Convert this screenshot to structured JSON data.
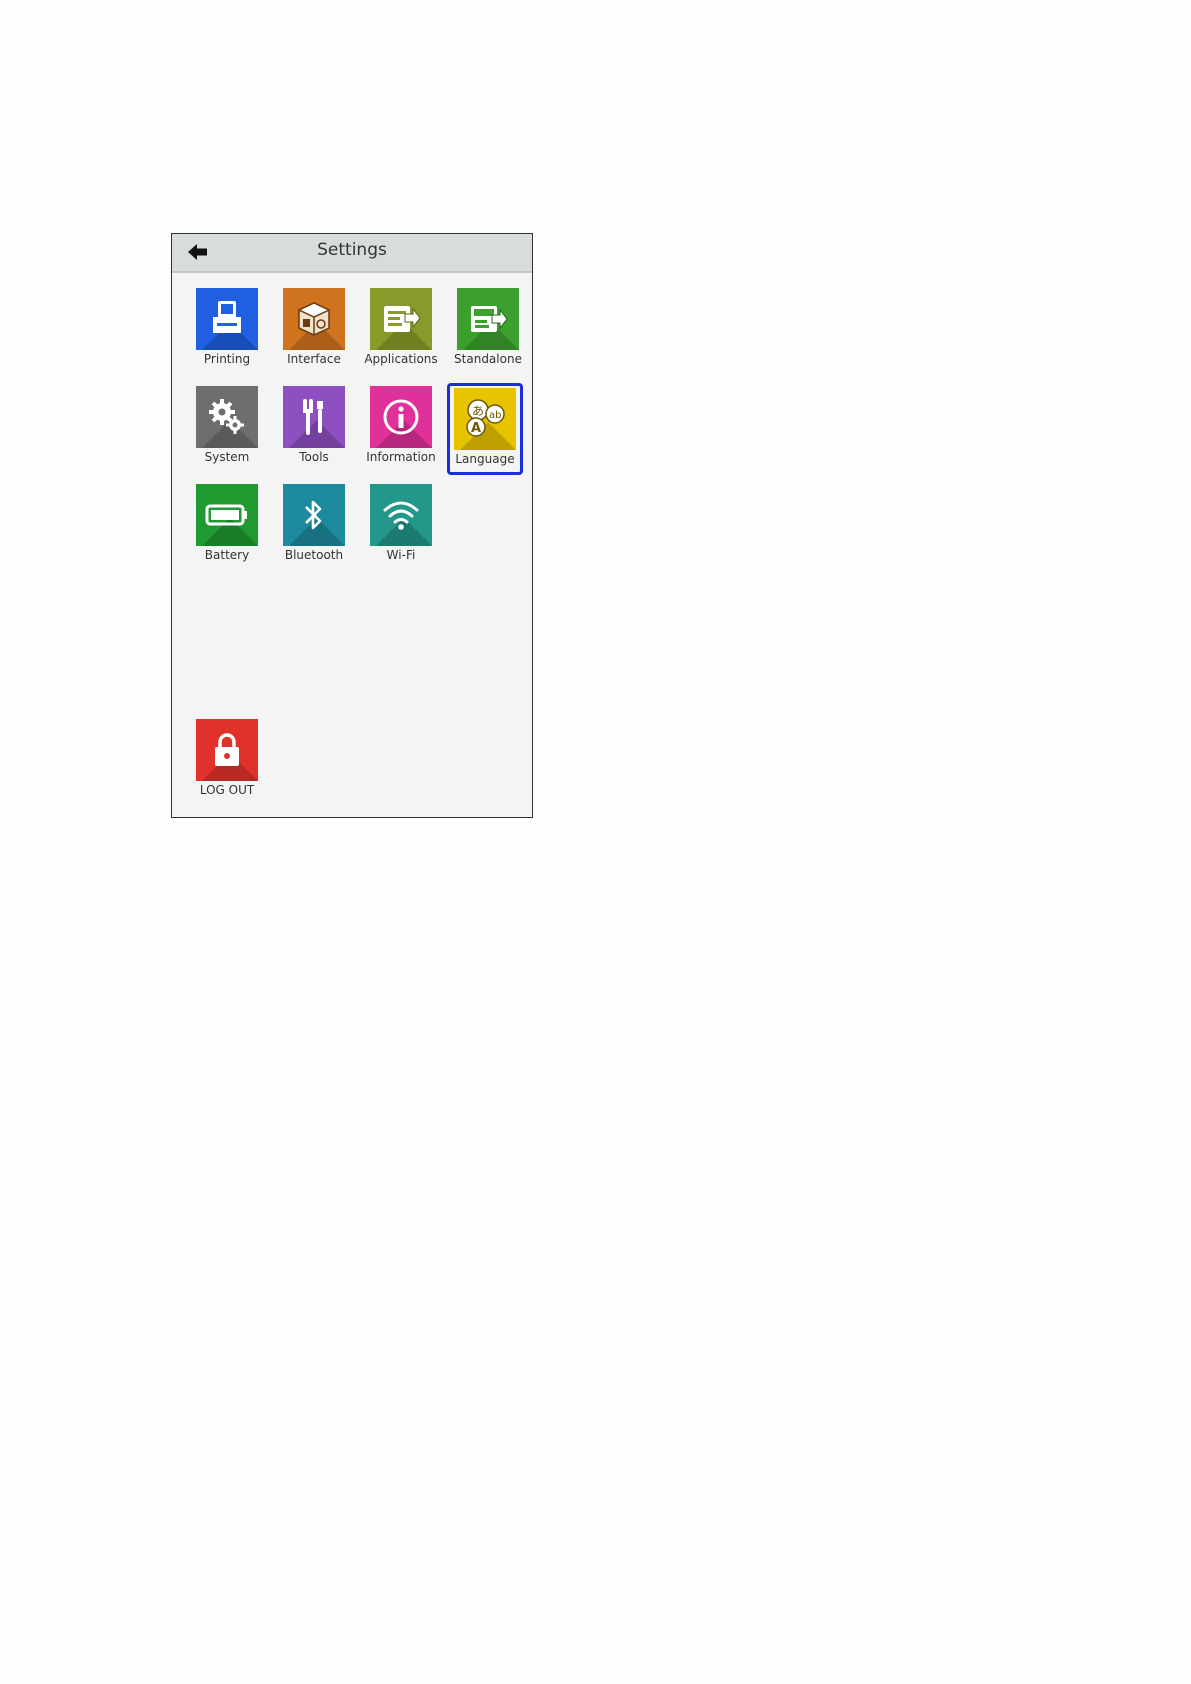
{
  "header": {
    "title": "Settings"
  },
  "items": [
    {
      "label": "Printing",
      "color": "#1f5fe0",
      "icon": "printer-icon"
    },
    {
      "label": "Interface",
      "color": "#d0731e",
      "icon": "interface-cube-icon"
    },
    {
      "label": "Applications",
      "color": "#8a9a2a",
      "icon": "applications-icon"
    },
    {
      "label": "Standalone",
      "color": "#3ca02e",
      "icon": "standalone-icon"
    },
    {
      "label": "System",
      "color": "#6e6e6e",
      "icon": "gears-icon"
    },
    {
      "label": "Tools",
      "color": "#8e4fc0",
      "icon": "tools-icon"
    },
    {
      "label": "Information",
      "color": "#e0309a",
      "icon": "info-icon"
    },
    {
      "label": "Language",
      "color": "#e8c400",
      "icon": "language-icon"
    },
    {
      "label": "Battery",
      "color": "#1f9a30",
      "icon": "battery-icon"
    },
    {
      "label": "Bluetooth",
      "color": "#1e8a9e",
      "icon": "bluetooth-icon"
    },
    {
      "label": "Wi-Fi",
      "color": "#22978a",
      "icon": "wifi-icon"
    },
    {
      "label": "LOG OUT",
      "color": "#e0322a",
      "icon": "lock-icon"
    }
  ],
  "selected": "Language"
}
